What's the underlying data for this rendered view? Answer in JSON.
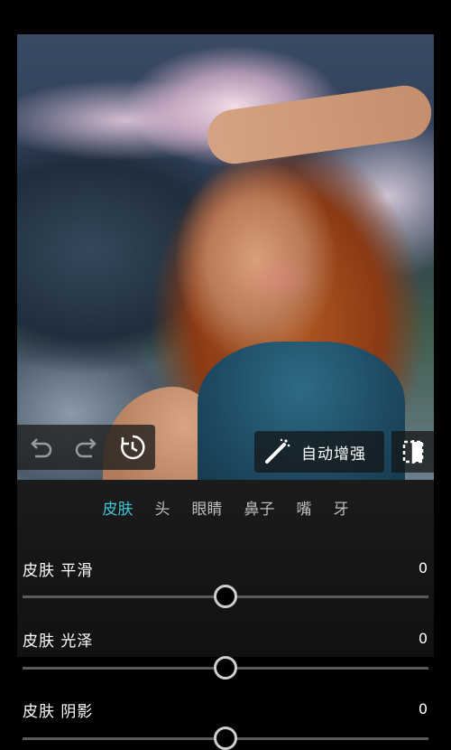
{
  "toolbar": {
    "enhance_label": "自动增强"
  },
  "tabs": [
    {
      "label": "皮肤",
      "active": true
    },
    {
      "label": "头",
      "active": false
    },
    {
      "label": "眼睛",
      "active": false
    },
    {
      "label": "鼻子",
      "active": false
    },
    {
      "label": "嘴",
      "active": false
    },
    {
      "label": "牙",
      "active": false
    }
  ],
  "sliders": [
    {
      "label": "皮肤 平滑",
      "value": "0",
      "level": 0.5
    },
    {
      "label": "皮肤 光泽",
      "value": "0",
      "level": 0.5
    },
    {
      "label": "皮肤 阴影",
      "value": "0",
      "level": 0.5
    }
  ],
  "colors": {
    "accent": "#3fc6d8",
    "track": "#5a5a5a"
  },
  "icons": {
    "undo": "undo-icon",
    "redo": "redo-icon",
    "reset": "reset-history-icon",
    "enhance": "magic-wand-icon",
    "compare": "compare-icon"
  }
}
